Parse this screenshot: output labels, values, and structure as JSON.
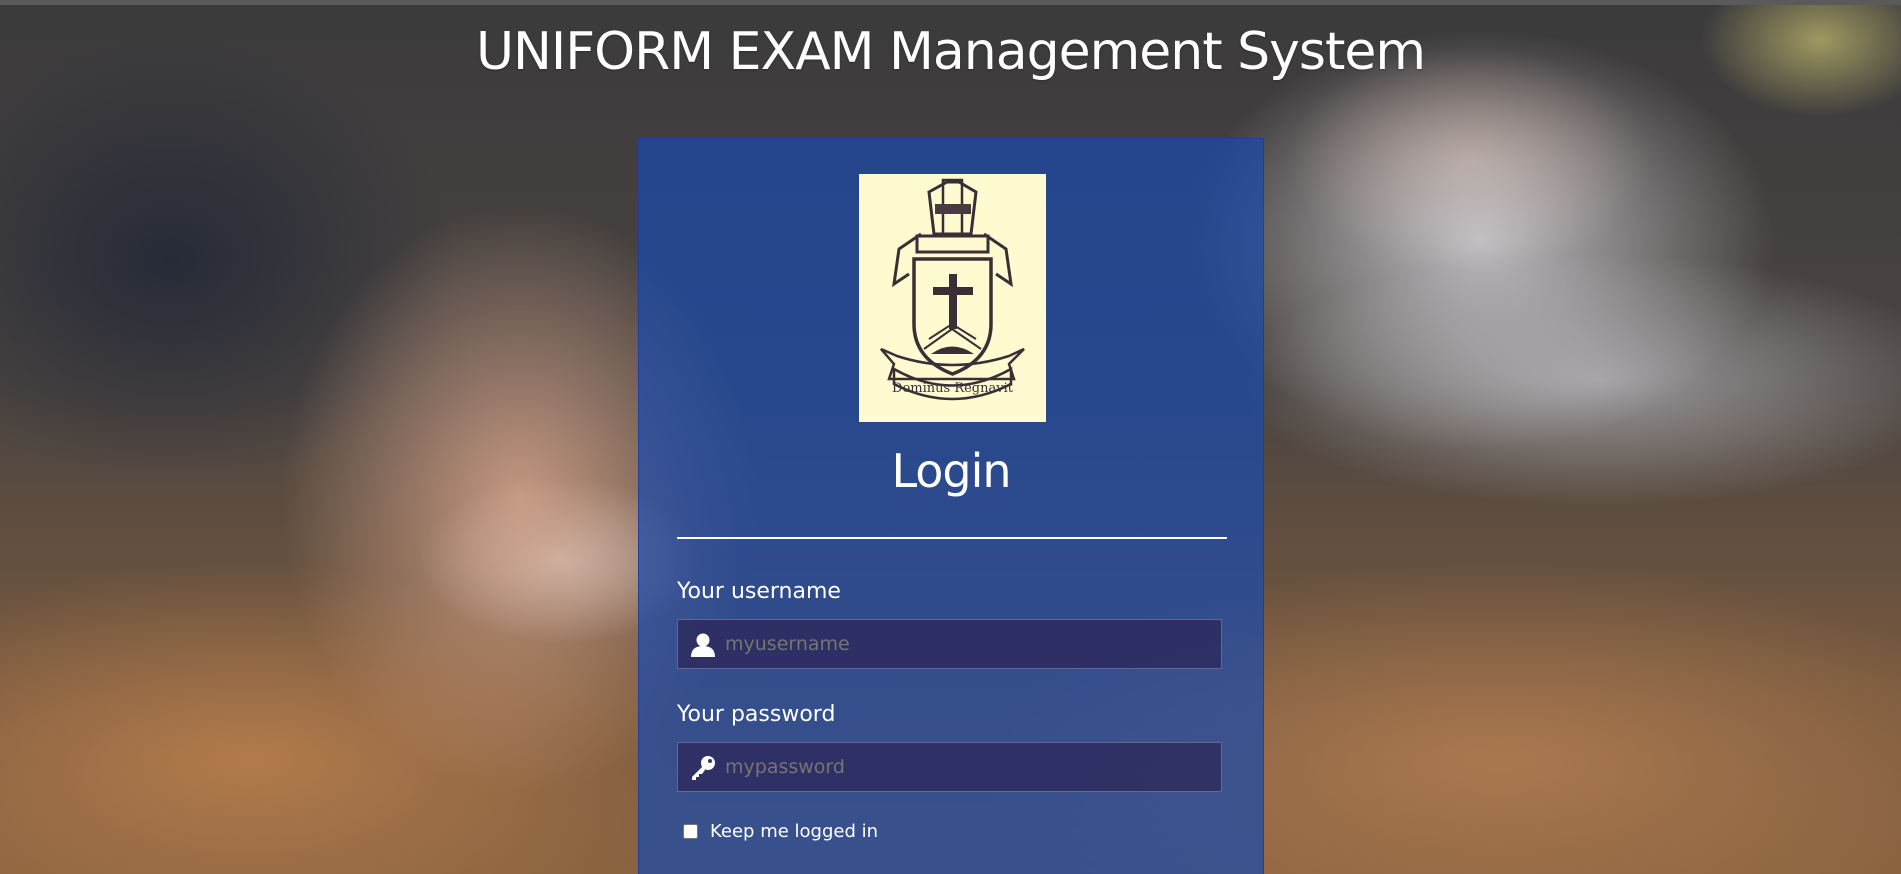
{
  "header": {
    "title": "UNIFORM EXAM Management System"
  },
  "login": {
    "crest_icon": "crest-emblem-icon",
    "crest_motto": "Dominus Regnavit",
    "title": "Login",
    "username": {
      "label": "Your username",
      "placeholder": "myusername",
      "icon": "user-icon"
    },
    "password": {
      "label": "Your password",
      "placeholder": "mypassword",
      "icon": "key-icon"
    },
    "keep_logged_in": {
      "label": "Keep me logged in",
      "checked": false
    }
  },
  "colors": {
    "panel": "#1a4aaa",
    "input_bg": "#2d285a",
    "text": "#ffffff",
    "crest_bg": "#fdfbcf"
  }
}
